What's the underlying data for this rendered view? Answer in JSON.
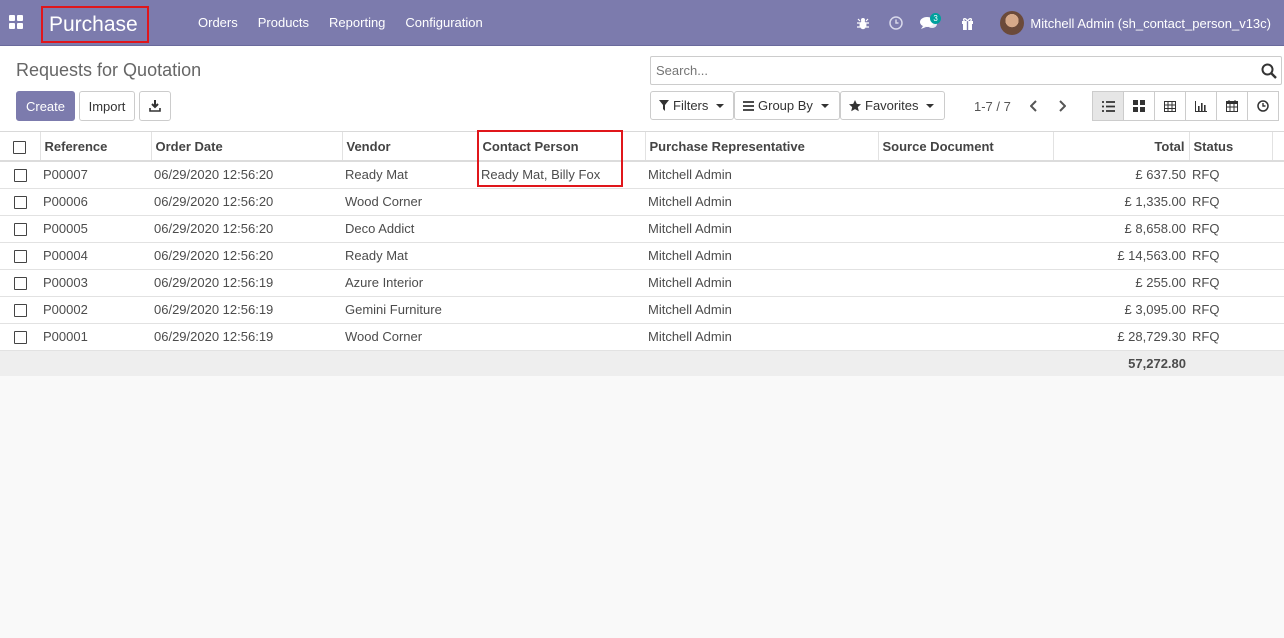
{
  "navbar": {
    "brand": "Purchase",
    "menu": [
      "Orders",
      "Products",
      "Reporting",
      "Configuration"
    ],
    "messages_count": "3",
    "user_name": "Mitchell Admin (sh_contact_person_v13c)"
  },
  "control": {
    "title": "Requests for Quotation",
    "create_label": "Create",
    "import_label": "Import",
    "search_placeholder": "Search...",
    "filters_label": "Filters",
    "groupby_label": "Group By",
    "favorites_label": "Favorites",
    "pager": "1-7 / 7"
  },
  "table": {
    "columns": {
      "reference": "Reference",
      "order_date": "Order Date",
      "vendor": "Vendor",
      "contact_person": "Contact Person",
      "representative": "Purchase Representative",
      "source_document": "Source Document",
      "total": "Total",
      "status": "Status"
    },
    "rows": [
      {
        "reference": "P00007",
        "order_date": "06/29/2020 12:56:20",
        "vendor": "Ready Mat",
        "contact_person": "Ready Mat, Billy Fox",
        "representative": "Mitchell Admin",
        "source_document": "",
        "total": "£ 637.50",
        "status": "RFQ"
      },
      {
        "reference": "P00006",
        "order_date": "06/29/2020 12:56:20",
        "vendor": "Wood Corner",
        "contact_person": "",
        "representative": "Mitchell Admin",
        "source_document": "",
        "total": "£ 1,335.00",
        "status": "RFQ"
      },
      {
        "reference": "P00005",
        "order_date": "06/29/2020 12:56:20",
        "vendor": "Deco Addict",
        "contact_person": "",
        "representative": "Mitchell Admin",
        "source_document": "",
        "total": "£ 8,658.00",
        "status": "RFQ"
      },
      {
        "reference": "P00004",
        "order_date": "06/29/2020 12:56:20",
        "vendor": "Ready Mat",
        "contact_person": "",
        "representative": "Mitchell Admin",
        "source_document": "",
        "total": "£ 14,563.00",
        "status": "RFQ"
      },
      {
        "reference": "P00003",
        "order_date": "06/29/2020 12:56:19",
        "vendor": "Azure Interior",
        "contact_person": "",
        "representative": "Mitchell Admin",
        "source_document": "",
        "total": "£ 255.00",
        "status": "RFQ"
      },
      {
        "reference": "P00002",
        "order_date": "06/29/2020 12:56:19",
        "vendor": "Gemini Furniture",
        "contact_person": "",
        "representative": "Mitchell Admin",
        "source_document": "",
        "total": "£ 3,095.00",
        "status": "RFQ"
      },
      {
        "reference": "P00001",
        "order_date": "06/29/2020 12:56:19",
        "vendor": "Wood Corner",
        "contact_person": "",
        "representative": "Mitchell Admin",
        "source_document": "",
        "total": "£ 28,729.30",
        "status": "RFQ"
      }
    ],
    "grand_total": "57,272.80"
  },
  "colors": {
    "navbar": "#7c7bad",
    "highlight": "#e0161b"
  }
}
